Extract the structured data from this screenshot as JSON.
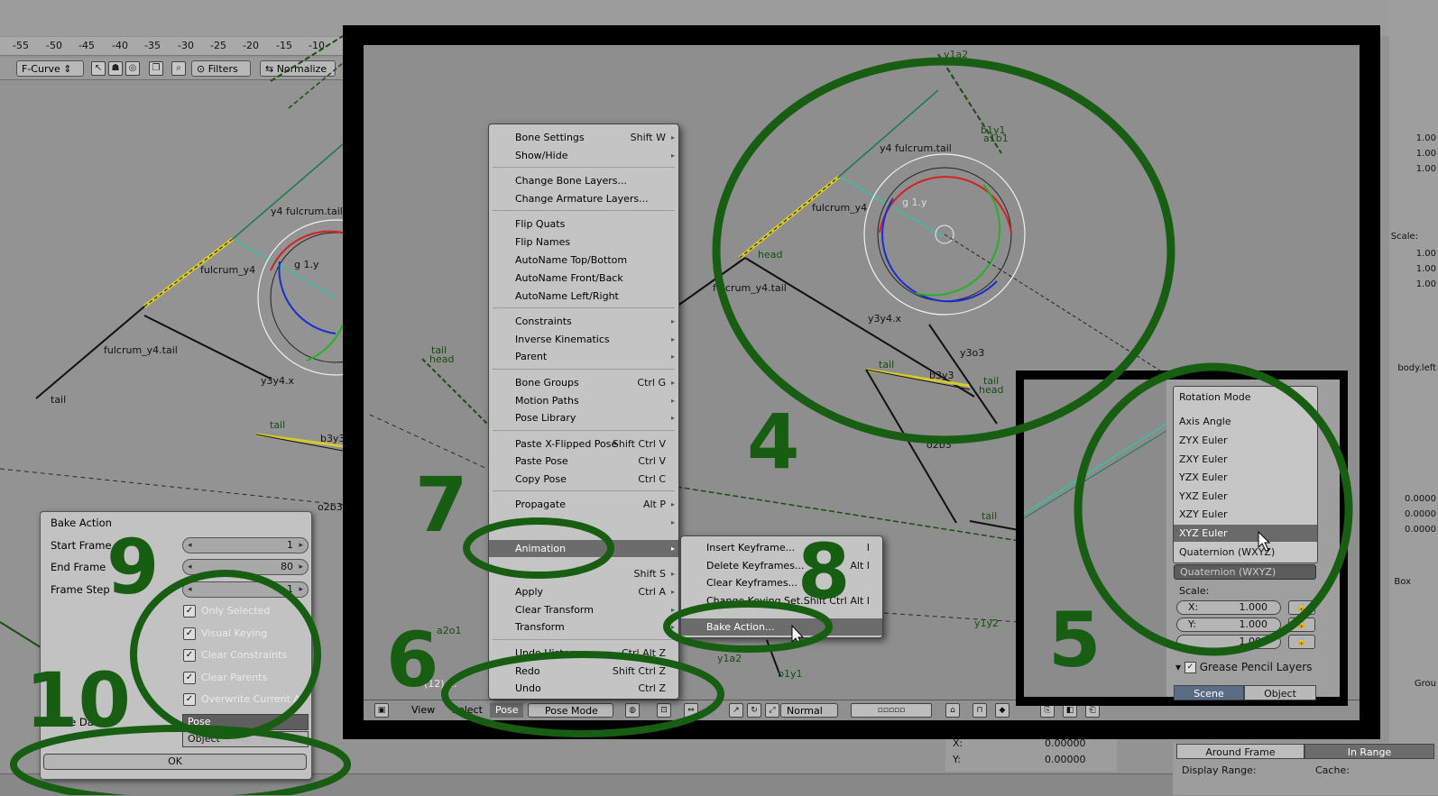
{
  "colors": {
    "annotation_green": "#175d12",
    "highlight": "#6c6c6c",
    "menu_bg": "#c4c4c4",
    "panel_bg": "#c2c2c2"
  },
  "graph_editor": {
    "ruler_ticks": [
      "-55",
      "-50",
      "-45",
      "-40",
      "-35",
      "-30",
      "-25",
      "-20",
      "-15",
      "-10"
    ],
    "header": {
      "curve_type": "F-Curve",
      "filters_label": "Filters",
      "normalize_label": "Normalize"
    }
  },
  "bake_panel": {
    "title": "Bake Action",
    "start_frame_label": "Start Frame",
    "start_frame_value": "1",
    "end_frame_label": "End Frame",
    "end_frame_value": "80",
    "frame_step_label": "Frame Step",
    "frame_step_value": "1",
    "checkboxes": [
      "Only Selected",
      "Visual Keying",
      "Clear Constraints",
      "Clear Parents",
      "Overwrite Current A"
    ],
    "bake_data_label": "Bake Data",
    "bake_data_options": [
      "Pose",
      "Object"
    ],
    "ok_label": "OK"
  },
  "pose_menu": {
    "items": [
      {
        "label": "Bone Settings",
        "shortcut": "Shift W"
      },
      {
        "label": "Show/Hide",
        "shortcut": ""
      },
      {
        "label": "Change Bone Layers...",
        "shortcut": ""
      },
      {
        "label": "Change Armature Layers...",
        "shortcut": ""
      },
      {
        "label": "Flip Quats",
        "shortcut": ""
      },
      {
        "label": "Flip Names",
        "shortcut": ""
      },
      {
        "label": "AutoName Top/Bottom",
        "shortcut": ""
      },
      {
        "label": "AutoName Front/Back",
        "shortcut": ""
      },
      {
        "label": "AutoName Left/Right",
        "shortcut": ""
      },
      {
        "label": "Constraints",
        "shortcut": ""
      },
      {
        "label": "Inverse Kinematics",
        "shortcut": ""
      },
      {
        "label": "Parent",
        "shortcut": ""
      },
      {
        "label": "Bone Groups",
        "shortcut": "Ctrl G"
      },
      {
        "label": "Motion Paths",
        "shortcut": ""
      },
      {
        "label": "Pose Library",
        "shortcut": ""
      },
      {
        "label": "Paste X-Flipped Pose",
        "shortcut": "Shift Ctrl V"
      },
      {
        "label": "Paste Pose",
        "shortcut": "Ctrl V"
      },
      {
        "label": "Copy Pose",
        "shortcut": "Ctrl C"
      },
      {
        "label": "Propagate",
        "shortcut": "Alt P"
      },
      {
        "label": "",
        "shortcut": ""
      },
      {
        "label": "Animation",
        "shortcut": ""
      },
      {
        "label": "",
        "shortcut": "Shift S"
      },
      {
        "label": "Apply",
        "shortcut": "Ctrl A"
      },
      {
        "label": "Clear Transform",
        "shortcut": ""
      },
      {
        "label": "Transform",
        "shortcut": ""
      },
      {
        "label": "Undo History",
        "shortcut": "Ctrl Alt Z"
      },
      {
        "label": "Redo",
        "shortcut": "Shift Ctrl Z"
      },
      {
        "label": "Undo",
        "shortcut": "Ctrl Z"
      }
    ]
  },
  "animation_menu": {
    "items": [
      {
        "label": "Insert Keyframe...",
        "shortcut": "I"
      },
      {
        "label": "Delete Keyframes...",
        "shortcut": "Alt I"
      },
      {
        "label": "Clear Keyframes...",
        "shortcut": ""
      },
      {
        "label": "Change Keying Set...",
        "shortcut": "Shift Ctrl Alt I"
      },
      {
        "label": "Bake Action...",
        "shortcut": ""
      }
    ]
  },
  "viewport_header": {
    "view": "View",
    "select": "Select",
    "pose": "Pose",
    "mode": "Pose Mode",
    "pivot": "Normal",
    "status": "(12) ..."
  },
  "rotation_mode": {
    "title": "Rotation Mode",
    "options": [
      "Axis Angle",
      "ZYX Euler",
      "ZXY Euler",
      "YZX Euler",
      "YXZ Euler",
      "XZY Euler",
      "XYZ Euler",
      "Quaternion (WXYZ)"
    ],
    "selected": "XYZ Euler",
    "current_value": "Quaternion (WXYZ)",
    "scale_label": "Scale:",
    "scale": [
      {
        "axis": "X:",
        "value": "1.000"
      },
      {
        "axis": "Y:",
        "value": "1.000"
      },
      {
        "axis": "Z:",
        "value": "1.000"
      }
    ],
    "grease_pencil_label": "Grease Pencil Layers",
    "scene_tab": "Scene",
    "object_tab": "Object"
  },
  "bone_labels": [
    "tail",
    "head",
    "y1a2",
    "a1b1",
    "b1y1",
    "y4 fulcrum.tail",
    "fulcrum_y4",
    "fulcrum_y4.tail",
    "g 1.y",
    "y3y4.x",
    "y3o3",
    "b3y3",
    "o2b3",
    "a2o1",
    "y1y2",
    "b1y1",
    "y1a2"
  ],
  "step_numbers": [
    "4",
    "5",
    "6",
    "7",
    "8",
    "9",
    "10"
  ],
  "bottom_right": {
    "around_frame": "Around Frame",
    "in_range": "In Range",
    "display_range": "Display Range:",
    "cache": "Cache:",
    "x_label": "X:",
    "x_value": "0.00000",
    "y_label": "Y:",
    "y_value": "0.00000"
  },
  "right_panel_values": [
    "1.00",
    "1.00",
    "1.00",
    "Scale:",
    "1.00",
    "1.00",
    "1.00",
    "0.0000",
    "0.0000",
    "0.0000",
    "body.left",
    "Box",
    "Grou"
  ]
}
